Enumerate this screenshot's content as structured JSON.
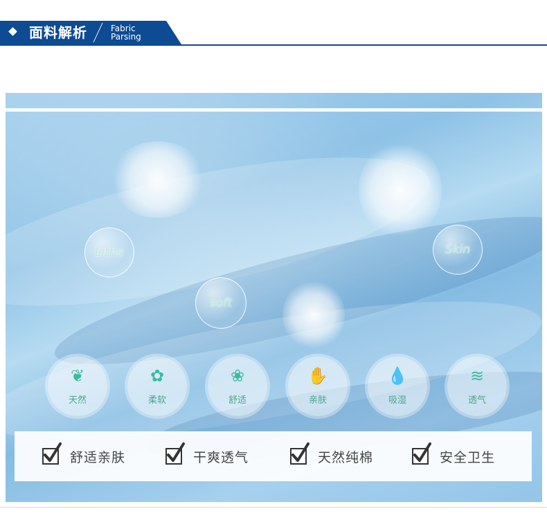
{
  "header": {
    "title": "面料解析",
    "subtitle_line1": "Fabric",
    "subtitle_line2": "Parsing"
  },
  "bubbles": [
    "Lithe",
    "soft",
    "Skin"
  ],
  "badges": [
    {
      "icon": "sprout-icon",
      "glyph": "❦",
      "label": "天然"
    },
    {
      "icon": "cotton-flower-icon",
      "glyph": "✿",
      "label": "柔软"
    },
    {
      "icon": "flower-icon",
      "glyph": "❀",
      "label": "舒适"
    },
    {
      "icon": "hand-icon",
      "glyph": "✋",
      "label": "亲肤"
    },
    {
      "icon": "water-drops-icon",
      "glyph": "💧",
      "label": "吸湿"
    },
    {
      "icon": "air-wave-icon",
      "glyph": "≋",
      "label": "透气"
    }
  ],
  "features": [
    "舒适亲肤",
    "干爽透气",
    "天然纯棉",
    "安全卫生"
  ],
  "colors": {
    "brand_blue": "#0d4b93",
    "fabric_blue": "#9ccbeb",
    "accent_green": "#3dba9c"
  }
}
